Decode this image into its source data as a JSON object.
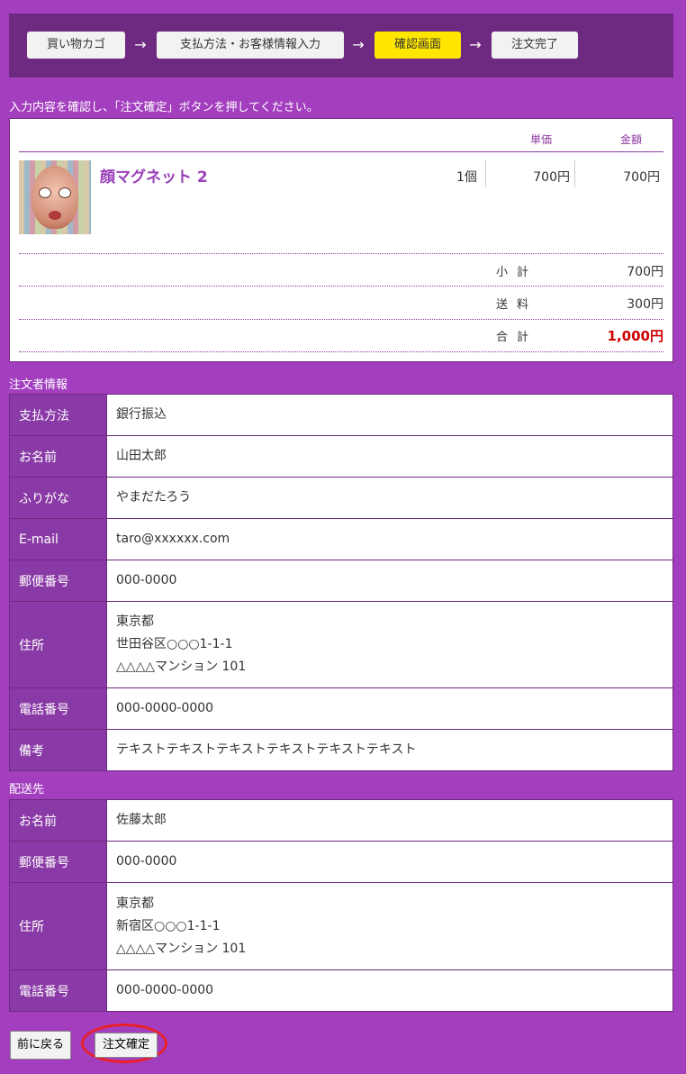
{
  "steps": [
    {
      "label": "買い物カゴ",
      "active": false
    },
    {
      "label": "支払方法・お客様情報入力",
      "active": false
    },
    {
      "label": "確認画面",
      "active": true
    },
    {
      "label": "注文完了",
      "active": false
    }
  ],
  "step_arrow": "→",
  "instruction": "入力内容を確認し、「注文確定」ボタンを押してください。",
  "cart": {
    "col_unit_price": "単価",
    "col_amount": "金額",
    "item": {
      "name": "顔マグネット 2",
      "quantity": "1個",
      "unit_price": "700円",
      "amount": "700円"
    },
    "subtotal_label": "小計",
    "subtotal": "700円",
    "shipping_label": "送料",
    "shipping": "300円",
    "total_label": "合計",
    "total": "1,000円"
  },
  "orderer": {
    "title": "注文者情報",
    "payment_label": "支払方法",
    "payment": "銀行振込",
    "name_label": "お名前",
    "name": "山田太郎",
    "kana_label": "ふりがな",
    "kana": "やまだたろう",
    "email_label": "E-mail",
    "email": "taro@xxxxxx.com",
    "zip_label": "郵便番号",
    "zip": "000-0000",
    "address_label": "住所",
    "address_line1": "東京都",
    "address_line2": "世田谷区○○○1-1-1",
    "address_line3": "△△△△マンション 101",
    "phone_label": "電話番号",
    "phone": "000-0000-0000",
    "note_label": "備考",
    "note": "テキストテキストテキストテキストテキストテキスト"
  },
  "shipping_dest": {
    "title": "配送先",
    "name_label": "お名前",
    "name": "佐藤太郎",
    "zip_label": "郵便番号",
    "zip": "000-0000",
    "address_label": "住所",
    "address_line1": "東京都",
    "address_line2": "新宿区○○○1-1-1",
    "address_line3": "△△△△マンション 101",
    "phone_label": "電話番号",
    "phone": "000-0000-0000"
  },
  "buttons": {
    "back": "前に戻る",
    "confirm": "注文確定"
  },
  "colors": {
    "background": "#a33fbf",
    "header_bar": "#6e2a80",
    "active_step": "#ffe600",
    "label_cell": "#8a3aa6",
    "total_red": "#cc0000",
    "highlight_ring": "#e8202a"
  }
}
